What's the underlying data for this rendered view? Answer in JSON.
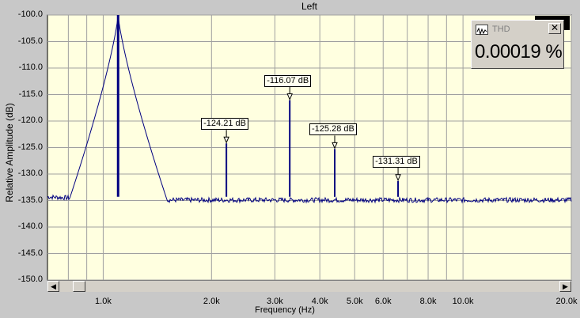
{
  "window": {
    "title": "Left"
  },
  "y_axis": {
    "label": "Relative Amplitude (dB)",
    "ticks": [
      "-100.0",
      "-105.0",
      "-110.0",
      "-115.0",
      "-120.0",
      "-125.0",
      "-130.0",
      "-135.0",
      "-140.0",
      "-145.0",
      "-150.0"
    ]
  },
  "x_axis": {
    "label": "Frequency (Hz)",
    "ticks": [
      "1.0k",
      "2.0k",
      "3.0k",
      "4.0k",
      "5.0k",
      "6.0k",
      "8.0k",
      "10.0k",
      "20.0k"
    ]
  },
  "markers": [
    {
      "label": "-124.21 dB"
    },
    {
      "label": "-116.07 dB"
    },
    {
      "label": "-125.28 dB"
    },
    {
      "label": "-131.31 dB"
    }
  ],
  "thd_panel": {
    "title": "THD",
    "value": "0.00019 %",
    "close": "✕",
    "icon": "waveform-icon"
  },
  "scrollbar": {
    "left_arrow": "◀",
    "right_arrow": "▶"
  },
  "colors": {
    "plot_bg": "#ffffe0",
    "trace": "#000080",
    "grid": "#a0a0a0",
    "window_bg": "#c8c8c8"
  },
  "chart_data": {
    "type": "line",
    "title": "Left",
    "xlabel": "Frequency (Hz)",
    "ylabel": "Relative Amplitude (dB)",
    "xscale": "log",
    "xlim": [
      700,
      20000
    ],
    "ylim": [
      -150,
      -100
    ],
    "grid": true,
    "fundamental_hz": 1100,
    "noise_floor_db": -134.3,
    "peaks": [
      {
        "x": 1100,
        "y": -100
      },
      {
        "x": 2200,
        "y": -124.21
      },
      {
        "x": 3300,
        "y": -116.07
      },
      {
        "x": 4400,
        "y": -125.28
      },
      {
        "x": 6600,
        "y": -131.31
      }
    ],
    "series": [
      {
        "values": []
      }
    ]
  }
}
